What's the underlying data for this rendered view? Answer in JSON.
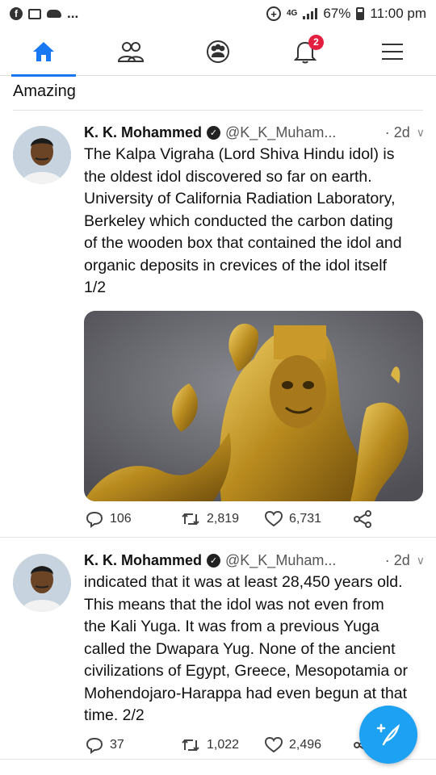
{
  "status_bar": {
    "battery": "67%",
    "time": "11:00 pm",
    "network": "4G",
    "left_icons": [
      "facebook-icon",
      "gallery-icon",
      "cloud-icon",
      "more-dots"
    ],
    "left_dots": "..."
  },
  "nav": {
    "items": [
      "home-icon",
      "friends-icon",
      "groups-icon",
      "notifications-icon",
      "menu-icon"
    ],
    "active": "home",
    "notification_count": "2",
    "accent": "#1877f2"
  },
  "post": {
    "caption": "Amazing"
  },
  "tweets": [
    {
      "name": "K. K. Mohammed",
      "verified": "verified-icon",
      "handle": "@K_K_Muham...",
      "time": "· 2d",
      "text_lines": [
        "The Kalpa Vigraha (Lord Shiva Hindu idol) is",
        "the oldest idol discovered so far on earth.",
        "University of California Radiation Laboratory,",
        "Berkeley which conducted the carbon dating",
        "of the wooden box that contained the idol and",
        "organic deposits in crevices of the idol itself",
        "1/2"
      ],
      "has_media": true,
      "replies": "106",
      "retweets": "2,819",
      "likes": "6,731"
    },
    {
      "name": "K. K. Mohammed",
      "verified": "verified-icon",
      "handle": "@K_K_Muham...",
      "time": "· 2d",
      "text_lines": [
        "indicated that it was at least 28,450 years old.",
        "This means that the idol was not even from",
        "the Kali Yuga. It was from a previous Yuga",
        "called the Dwapara Yug. None of the ancient",
        "civilizations of Egypt, Greece, Mesopotamia or",
        "Mohendojaro-Harappa had even begun at that",
        "time. 2/2"
      ],
      "has_media": false,
      "replies": "37",
      "retweets": "1,022",
      "likes": "2,496"
    }
  ],
  "colors": {
    "twitter_blue": "#1da1f2",
    "badge_red": "#e41e3f"
  }
}
